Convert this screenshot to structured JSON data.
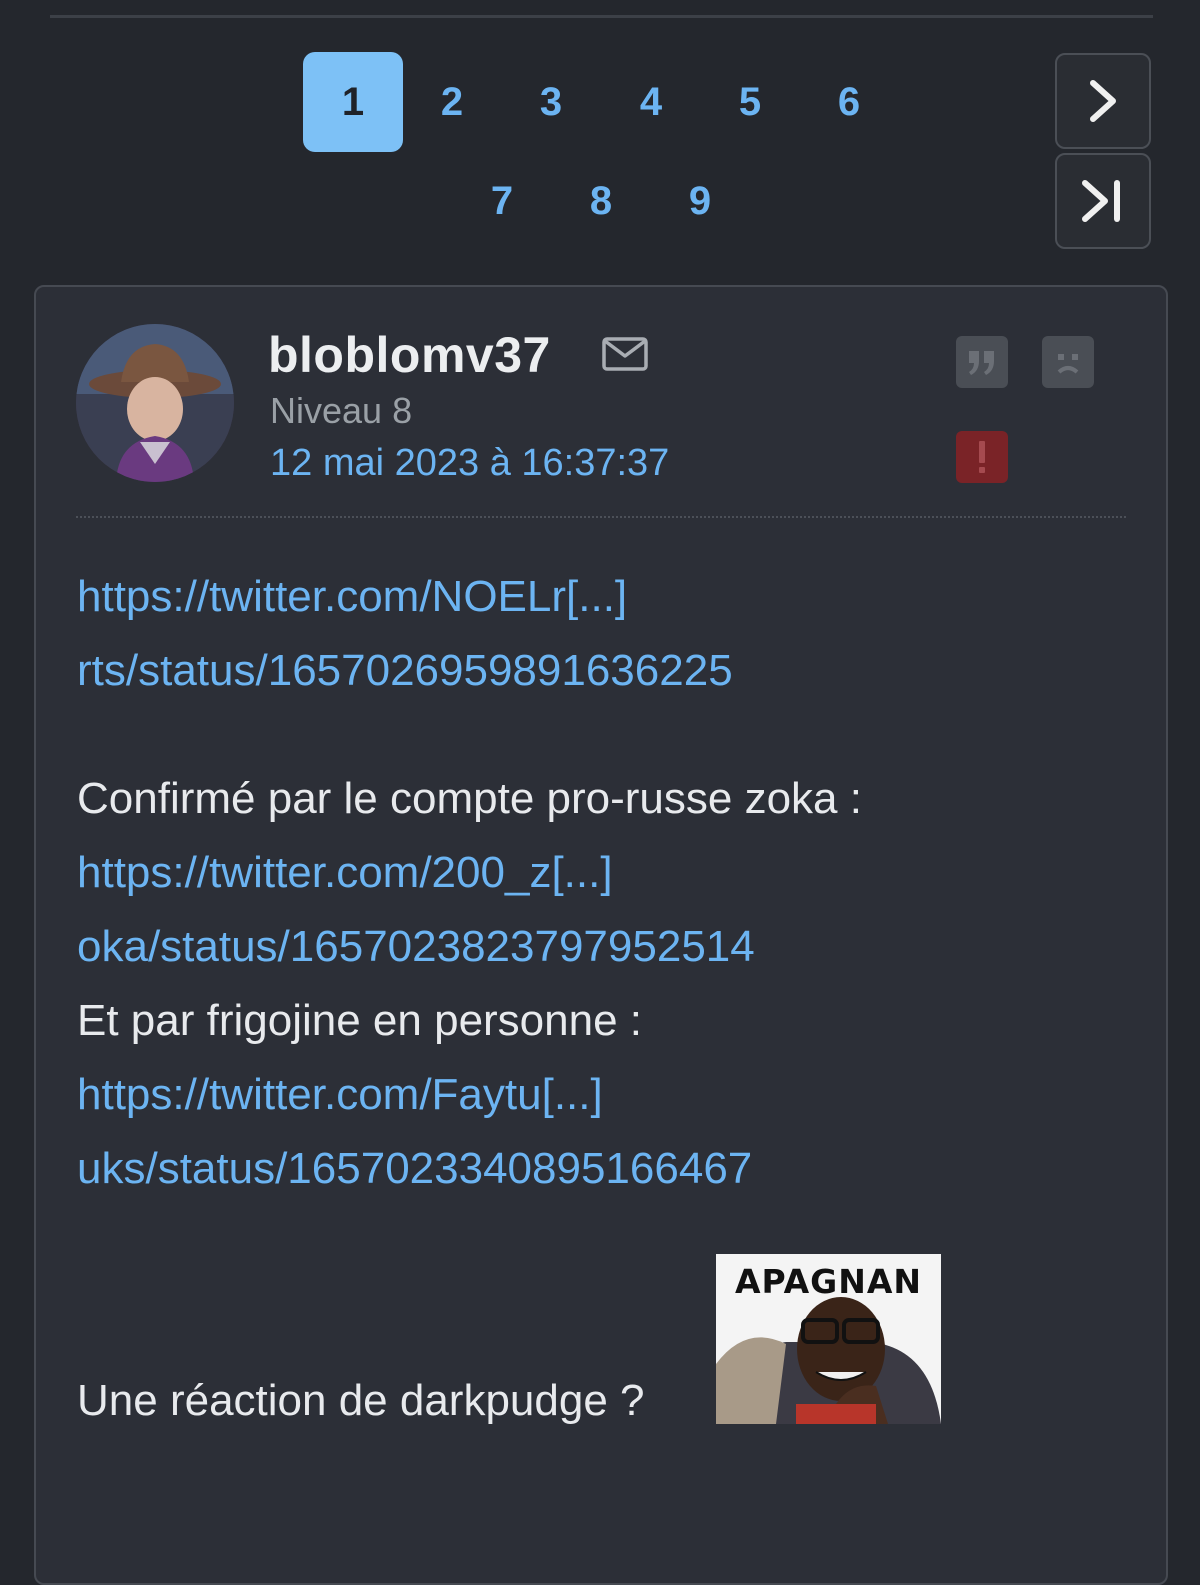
{
  "pagination": {
    "pages": [
      "1",
      "2",
      "3",
      "4",
      "5",
      "6",
      "7",
      "8",
      "9"
    ],
    "current": "1",
    "next_icon": "chevron-right-icon",
    "last_icon": "skip-to-last-icon"
  },
  "post": {
    "username": "bloblomv37",
    "level": "Niveau 8",
    "date": "12 mai 2023 à 16:37:37",
    "icons": {
      "message": "envelope-icon",
      "quote": "quote-icon",
      "blacklist": "sad-face-icon",
      "report": "exclamation-icon"
    },
    "colors": {
      "link": "#6cb4f2",
      "active_page": "#7dc1f6",
      "report": "#7a2327"
    },
    "content": {
      "link1_line1": "https://twitter.com/NOELr[...]",
      "link1_line2": "rts/status/1657026959891636225",
      "text1": "Confirmé par le compte pro-russe zoka :",
      "link2_line1": "https://twitter.com/200_z[...]",
      "link2_line2": "oka/status/1657023823797952514",
      "text2": "Et par frigojine en personne :",
      "link3_line1": "https://twitter.com/Faytu[...]",
      "link3_line2": "uks/status/1657023340895166467",
      "text3": "Une réaction de darkpudge ?",
      "sticker_text": "APAGNAN"
    }
  }
}
